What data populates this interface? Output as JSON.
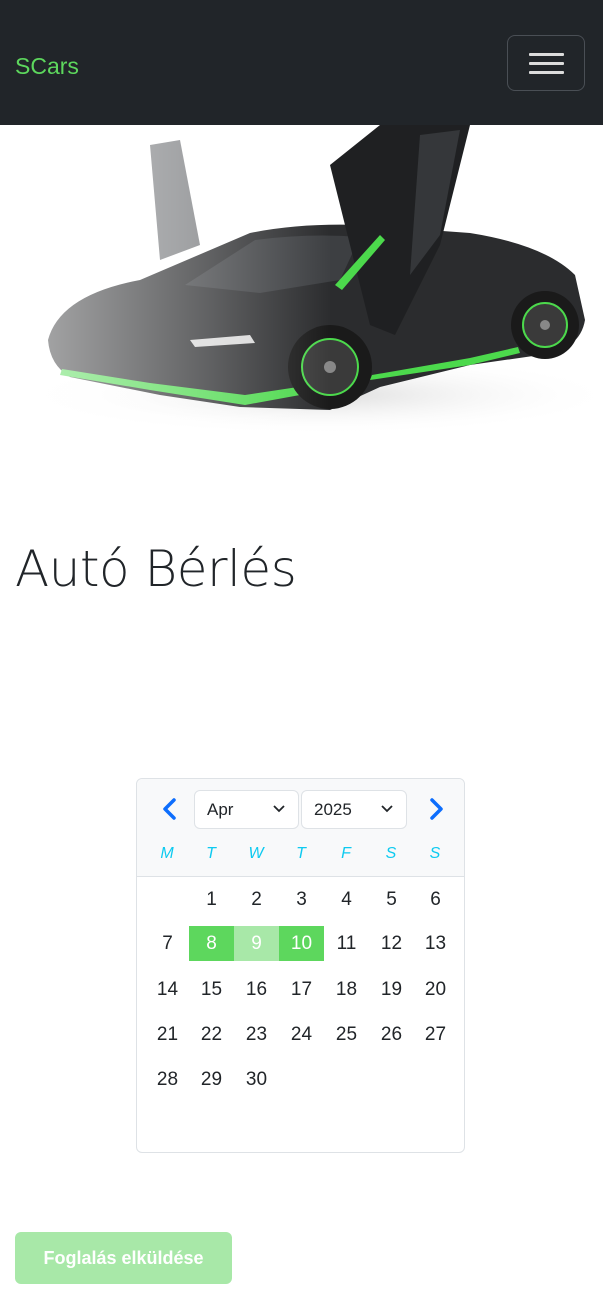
{
  "navbar": {
    "brand": "SCars",
    "toggle_icon": "hamburger-menu-icon"
  },
  "hero": {
    "image": "black-supercar-with-green-accents"
  },
  "page": {
    "title": "Autó Bérlés"
  },
  "datepicker": {
    "prev_icon": "chevron-left-icon",
    "next_icon": "chevron-right-icon",
    "month": "Apr",
    "year": "2025",
    "weekdays": [
      "M",
      "T",
      "W",
      "T",
      "F",
      "S",
      "S"
    ],
    "weeks": [
      [
        "",
        "1",
        "2",
        "3",
        "4",
        "5",
        "6"
      ],
      [
        "7",
        "8",
        "9",
        "10",
        "11",
        "12",
        "13"
      ],
      [
        "14",
        "15",
        "16",
        "17",
        "18",
        "19",
        "20"
      ],
      [
        "21",
        "22",
        "23",
        "24",
        "25",
        "26",
        "27"
      ],
      [
        "28",
        "29",
        "30",
        "",
        "",
        "",
        ""
      ]
    ],
    "selected_range": {
      "start": "8",
      "end": "10"
    }
  },
  "form": {
    "submit_label": "Foglalás elküldése"
  },
  "colors": {
    "brand_green": "#5dd75d",
    "range_green": "#a8e8a8",
    "link_blue": "#0d6efd",
    "weekday_cyan": "#0dcaf0"
  }
}
